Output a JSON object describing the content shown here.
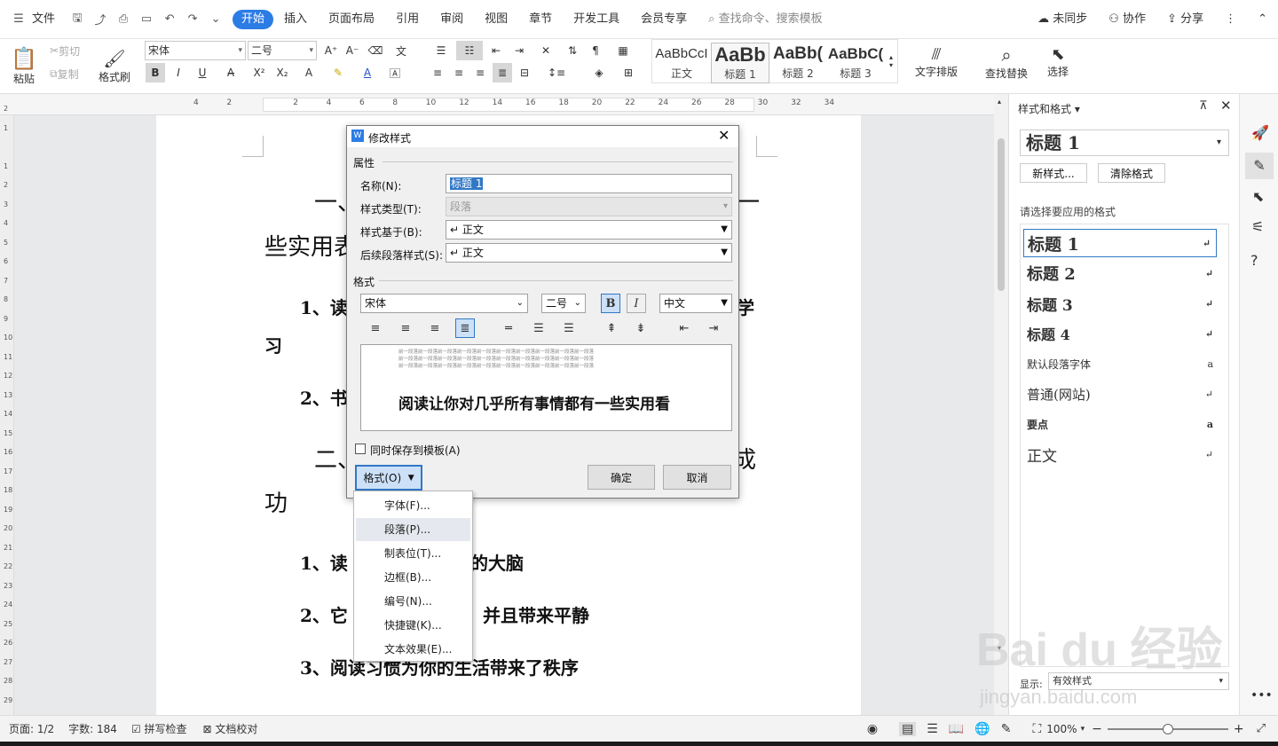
{
  "menubar": {
    "file": "文件",
    "tabs": [
      "开始",
      "插入",
      "页面布局",
      "引用",
      "审阅",
      "视图",
      "章节",
      "开发工具",
      "会员专享"
    ],
    "search_placeholder": "查找命令、搜索模板",
    "sync": "未同步",
    "collab": "协作",
    "share": "分享"
  },
  "ribbon": {
    "paste": "粘贴",
    "cut": "剪切",
    "copy": "复制",
    "format_painter": "格式刷",
    "font_name": "宋体",
    "font_size": "二号",
    "styles": [
      {
        "preview": "AaBbCcI",
        "label": "正文"
      },
      {
        "preview": "AaBb",
        "label": "标题 1"
      },
      {
        "preview": "AaBb(",
        "label": "标题 2"
      },
      {
        "preview": "AaBbC(",
        "label": "标题 3"
      }
    ],
    "text_layout": "文字排版",
    "find_replace": "查找替换",
    "select": "选择"
  },
  "ruler": {
    "ticks": [
      "4",
      "2",
      "",
      "2",
      "4",
      "6",
      "8",
      "10",
      "12",
      "14",
      "16",
      "18",
      "20",
      "22",
      "24",
      "26",
      "28",
      "30",
      "32",
      "34"
    ]
  },
  "vruler": {
    "ticks": [
      "2",
      "1",
      "",
      "1",
      "2",
      "3",
      "4",
      "5",
      "6",
      "7",
      "8",
      "9",
      "10",
      "11",
      "12",
      "13",
      "14",
      "15",
      "16",
      "17",
      "18",
      "19",
      "20",
      "21",
      "22",
      "23",
      "24",
      "25",
      "26",
      "27",
      "28",
      "29"
    ]
  },
  "document": {
    "line1_left": "一、",
    "line1_right": "一",
    "line2": "些实用表",
    "item1": "1、读",
    "item1_right": "学",
    "item1_wrap": "习",
    "item2": "2、书",
    "section2_left": "二、",
    "section2_right": "成",
    "section2_wrap": "功",
    "sub1_left": "1、读",
    "sub1_right": "的大脑",
    "sub2_left": "2、它",
    "sub2_right": "并且带来平静",
    "sub3": "3、阅读习惯为你的生活带来了秩序"
  },
  "panel": {
    "title": "样式和格式",
    "current_style": "标题  1",
    "new_style": "新样式...",
    "clear_format": "清除格式",
    "prompt": "请选择要应用的格式",
    "styles": [
      "标题  1",
      "标题  2",
      "标题  3",
      "标题  4",
      "默认段落字体",
      "普通(网站)",
      "要点",
      "正文"
    ],
    "show_label": "显示:",
    "show_value": "有效样式"
  },
  "dialog": {
    "title": "修改样式",
    "props_section": "属性",
    "name_label": "名称(N):",
    "name_value": "标题 1",
    "type_label": "样式类型(T):",
    "type_value": "段落",
    "based_label": "样式基于(B):",
    "based_value": "↵ 正文",
    "next_label": "后续段落样式(S):",
    "next_value": "↵ 正文",
    "format_section": "格式",
    "font": "宋体",
    "size": "二号",
    "bold": "B",
    "italic": "I",
    "lang": "中文",
    "preview_prev": "前一段落前一段落前一段落前一段落前一段落前一段落前一段落前一段落前一段落前一段落",
    "preview_text": "阅读让你对几乎所有事情都有一些实用看",
    "save_template": "同时保存到模板(A)",
    "format_btn": "格式(O)",
    "ok": "确定",
    "cancel": "取消"
  },
  "format_menu": [
    "字体(F)...",
    "段落(P)...",
    "制表位(T)...",
    "边框(B)...",
    "编号(N)...",
    "快捷键(K)...",
    "文本效果(E)..."
  ],
  "status": {
    "page": "页面: 1/2",
    "words": "字数: 184",
    "spell": "拼写检查",
    "proof": "文档校对",
    "zoom": "100%"
  },
  "watermark": {
    "main": "Bai du 经验",
    "sub": "jingyan.baidu.com"
  },
  "colors": {
    "accent": "#2c7ce5",
    "selection": "#3178c6",
    "menu_highlight": "#e5e9ef"
  }
}
